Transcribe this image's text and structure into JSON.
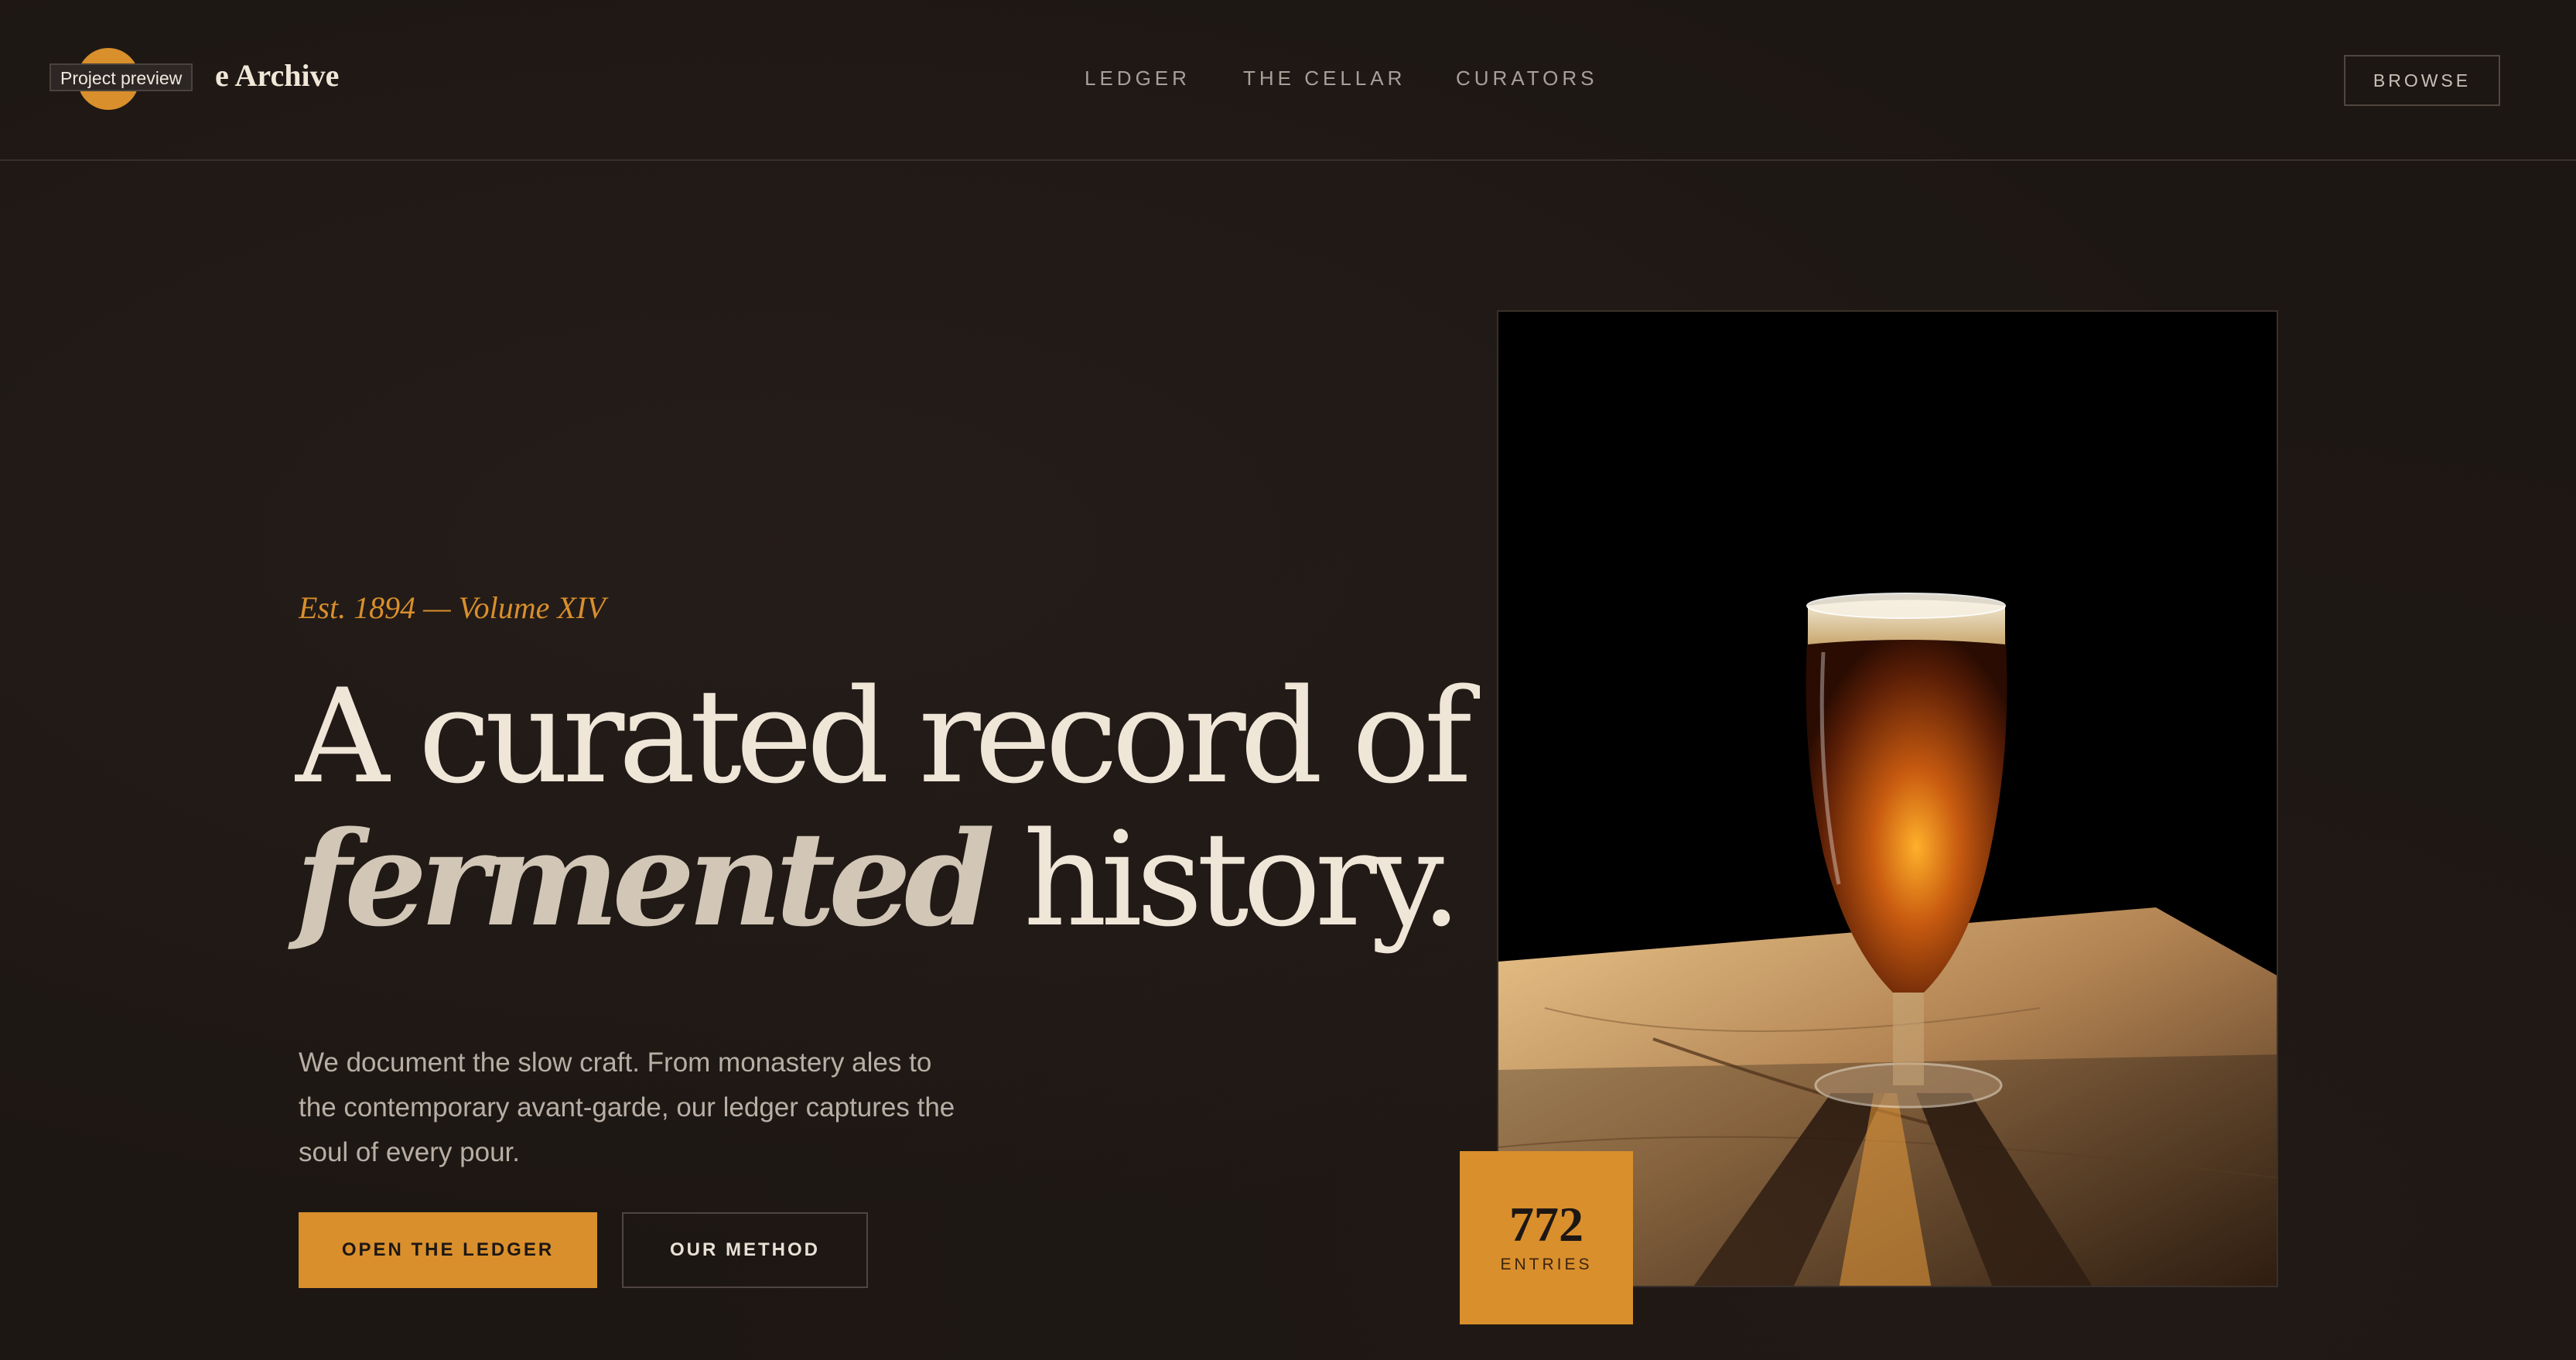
{
  "brand": {
    "name": "e Archive",
    "tooltip": "Project preview"
  },
  "nav": {
    "items": [
      "LEDGER",
      "THE CELLAR",
      "CURATORS"
    ],
    "cta": "BROWSE"
  },
  "hero": {
    "eyebrow": "Est. 1894 — Volume XIV",
    "headline_line1": "A curated record of",
    "headline_em": "fermented",
    "headline_rest": " history.",
    "lead": "We document the slow craft. From monastery ales to the contemporary avant-garde, our ledger captures the soul of every pour.",
    "primary_cta": "OPEN THE LEDGER",
    "secondary_cta": "OUR METHOD"
  },
  "stat": {
    "value": "772",
    "label": "ENTRIES"
  },
  "colors": {
    "background": "#1d1714",
    "accent": "#d98f2c",
    "text": "#efe6d8"
  }
}
